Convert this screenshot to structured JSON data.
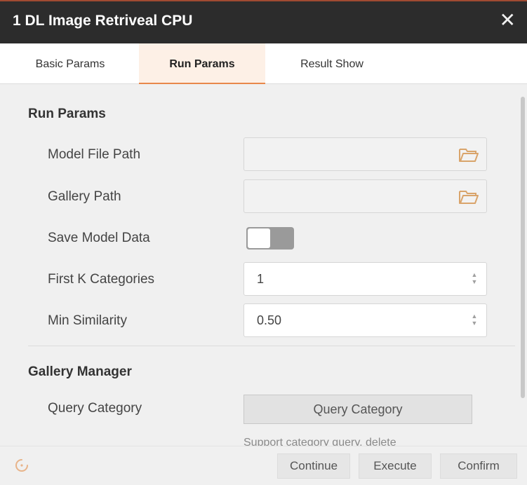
{
  "window": {
    "title": "1 DL Image Retriveal CPU",
    "close_glyph": "✕"
  },
  "tabs": [
    {
      "label": "Basic Params",
      "active": false
    },
    {
      "label": "Run Params",
      "active": true
    },
    {
      "label": "Result Show",
      "active": false
    }
  ],
  "run_params": {
    "section_title": "Run Params",
    "model_file_path": {
      "label": "Model File Path",
      "value": "",
      "icon": "folder-open-icon"
    },
    "gallery_path": {
      "label": "Gallery Path",
      "value": "",
      "icon": "folder-open-icon"
    },
    "save_model_data": {
      "label": "Save Model Data",
      "on": false
    },
    "first_k_categories": {
      "label": "First K Categories",
      "value": "1"
    },
    "min_similarity": {
      "label": "Min Similarity",
      "value": "0.50"
    }
  },
  "gallery_manager": {
    "section_title": "Gallery Manager",
    "query_category_label": "Query Category",
    "query_category_button": "Query Category",
    "hint": "Support category query, delete"
  },
  "footer": {
    "continue": "Continue",
    "execute": "Execute",
    "confirm": "Confirm"
  },
  "colors": {
    "titlebar": "#2c2c2c",
    "accent": "#e8884a",
    "panel": "#f0f0f0"
  }
}
